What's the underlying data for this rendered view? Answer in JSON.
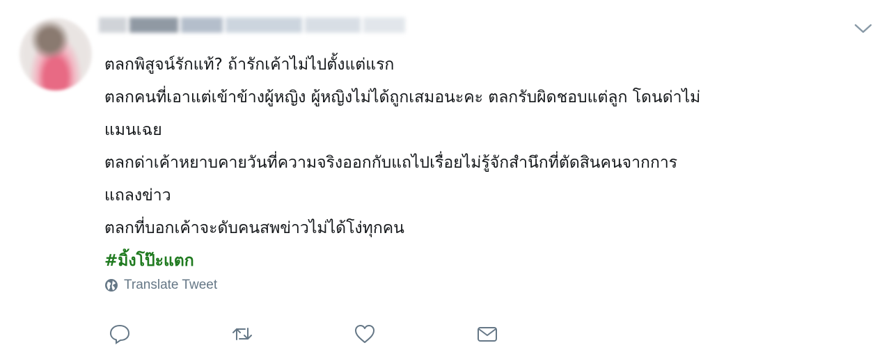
{
  "tweet": {
    "lines": [
      "ตลกพิสูจน์รักแท้? ถ้ารักเค้าไม่ไปตั้งแต่แรก",
      "ตลกคนที่เอาแต่เข้าข้างผู้หญิง ผู้หญิงไม่ได้ถูกเสมอนะคะ ตลกรับผิดชอบแต่ลูก โดนด่าไม่",
      "แมนเฉย",
      "ตลกด่าเค้าหยาบคายวันที่ความจริงออกกับแถไปเรื่อยไม่รู้จักสำนึกที่ตัดสินคนจากการ",
      "แถลงข่าว",
      "ตลกที่บอกเค้าจะดับคนสพข่าวไม่ได้โง่ทุกคน"
    ],
    "hashtag": "#มิ้งโป๊ะแตก",
    "translate_label": "Translate Tweet",
    "hashtag_color": "#1f7a1f"
  },
  "icons": {
    "more": "chevron-down-icon",
    "translate": "globe-icon",
    "reply": "reply-icon",
    "retweet": "retweet-icon",
    "like": "heart-icon",
    "dm": "envelope-icon"
  }
}
